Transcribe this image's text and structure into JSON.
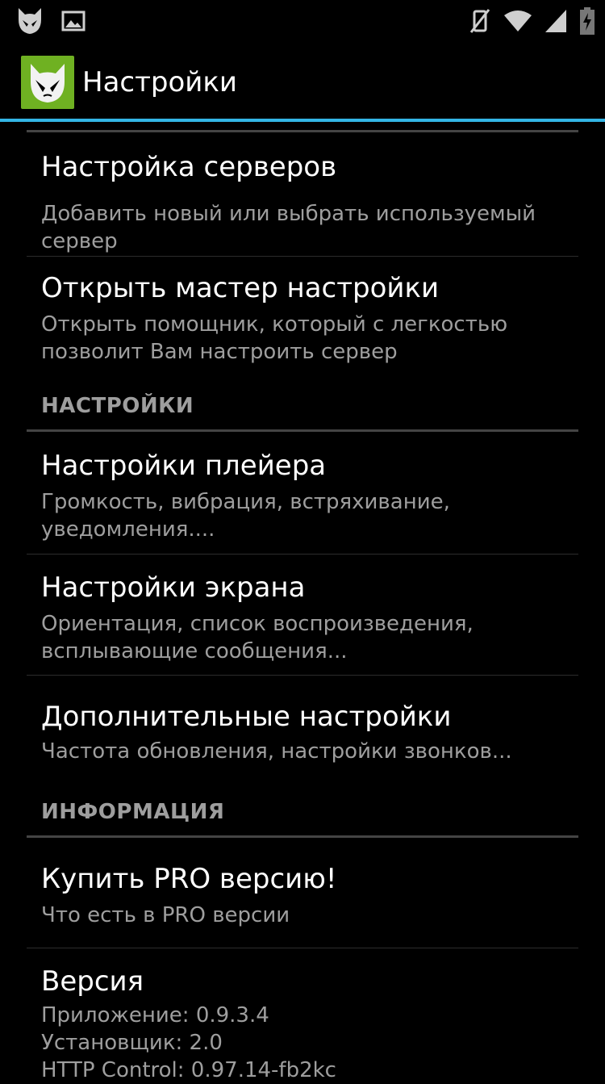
{
  "status_bar": {
    "left_icons": [
      "app-notification-icon",
      "image-icon"
    ],
    "right_icons": [
      "mute-icon",
      "wifi-icon",
      "signal-icon",
      "battery-charging-icon"
    ]
  },
  "action_bar": {
    "title": "Настройки",
    "accent_color": "#33b5e5",
    "icon_color": "#6fb122"
  },
  "prefs": {
    "servers": {
      "title": "Настройка серверов",
      "summary": [
        "Добавить новый или выбрать используемый",
        "сервер"
      ]
    },
    "wizard": {
      "title": "Открыть мастер настройки",
      "summary": [
        "Открыть помощник, который с легкостью",
        "позволит Вам настроить сервер"
      ]
    },
    "section_settings": "НАСТРОЙКИ",
    "player": {
      "title": "Настройки плейера",
      "summary": [
        "Громкость, вибрация, встряхивание,",
        "уведомления...."
      ]
    },
    "screen": {
      "title": "Настройки экрана",
      "summary": [
        "Ориентация, список воспроизведения,",
        "всплывающие сообщения..."
      ]
    },
    "advanced": {
      "title": "Дополнительные настройки",
      "summary": [
        "Частота обновления, настройки звонков..."
      ]
    },
    "section_info": "ИНФОРМАЦИЯ",
    "pro": {
      "title": "Купить PRO версию!",
      "summary": [
        "Что есть в PRO версии"
      ]
    },
    "version": {
      "title": "Версия",
      "summary": [
        "Приложение: 0.9.3.4",
        "Установщик: 2.0",
        "HTTP Control: 0.97.14-fb2kc"
      ]
    }
  }
}
